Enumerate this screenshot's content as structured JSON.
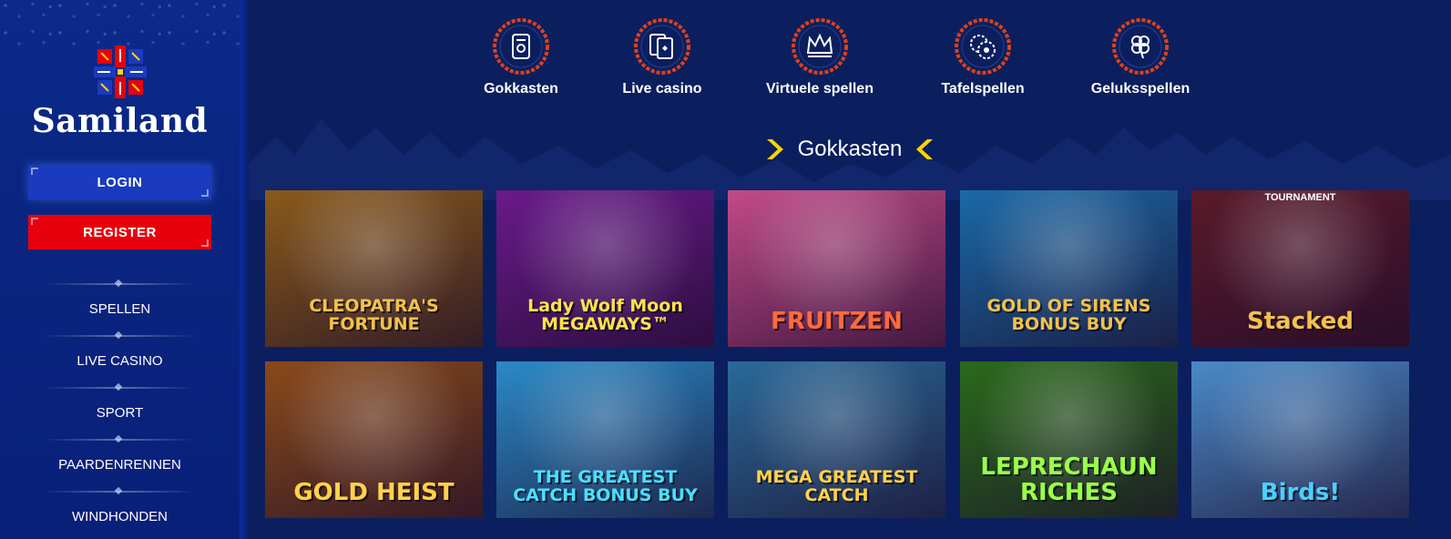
{
  "brand": {
    "name": "Samiland"
  },
  "auth": {
    "login_label": "LOGIN",
    "register_label": "REGISTER"
  },
  "nav": {
    "items": [
      {
        "label": "SPELLEN"
      },
      {
        "label": "LIVE CASINO"
      },
      {
        "label": "SPORT"
      },
      {
        "label": "PAARDENRENNEN"
      },
      {
        "label": "WINDHONDEN"
      }
    ]
  },
  "categories": [
    {
      "label": "Gokkasten",
      "icon": "slot-machine-icon"
    },
    {
      "label": "Live casino",
      "icon": "playing-cards-icon"
    },
    {
      "label": "Virtuele spellen",
      "icon": "crown-icon"
    },
    {
      "label": "Tafelspellen",
      "icon": "roulette-chip-icon"
    },
    {
      "label": "Geluksspellen",
      "icon": "four-leaf-clover-icon"
    }
  ],
  "section": {
    "title": "Gokkasten"
  },
  "games": [
    {
      "title": "CLEOPATRA'S FORTUNE",
      "bg": "#8a5a1a",
      "accent": "#f2c14e"
    },
    {
      "title": "Lady Wolf Moon MEGAWAYS™",
      "bg": "#6a1a8a",
      "accent": "#ffe24d"
    },
    {
      "title": "FRUITZEN",
      "bg": "#c24a8a",
      "accent": "#ff6a3a"
    },
    {
      "title": "GOLD OF SIRENS BONUS BUY",
      "bg": "#1a6aa8",
      "accent": "#f2c14e"
    },
    {
      "title": "Stacked",
      "sup": "TOURNAMENT",
      "bg": "#5a1a2a",
      "accent": "#f2c14e"
    },
    {
      "title": "GOLD HEIST",
      "bg": "#8a4a1a",
      "accent": "#ffd24a"
    },
    {
      "title": "THE GREATEST CATCH BONUS BUY",
      "bg": "#2a8ac8",
      "accent": "#4ae0ff"
    },
    {
      "title": "MEGA GREATEST CATCH",
      "bg": "#2a6a9a",
      "accent": "#ffd24a"
    },
    {
      "title": "LEPRECHAUN RICHES",
      "bg": "#2a6a1a",
      "accent": "#9aff4a"
    },
    {
      "title": "Birds!",
      "bg": "#4a8ac8",
      "accent": "#4ad0ff"
    }
  ],
  "colors": {
    "sidebar": "#0b2a8a",
    "main_bg": "#0b1f5e",
    "login": "#1a3bbf",
    "register": "#e8000d",
    "chevron": "#ffd400",
    "icon_ring": "#e0401a"
  }
}
